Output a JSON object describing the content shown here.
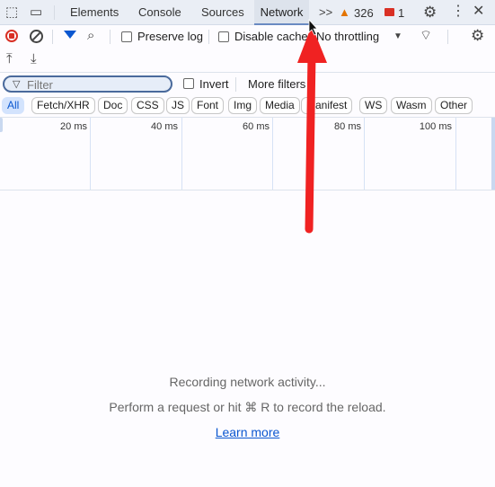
{
  "tabs": [
    "Elements",
    "Console",
    "Sources",
    "Network"
  ],
  "active_tab": "Network",
  "more_tabs": ">>",
  "warnings_count": "326",
  "errors_count": "1",
  "toolbar": {
    "preserve_log": "Preserve log",
    "disable_cache": "Disable cache",
    "throttling": "No throttling"
  },
  "filter": {
    "placeholder": "Filter",
    "invert": "Invert",
    "more_filters": "More filters"
  },
  "chips": [
    "All",
    "Fetch/XHR",
    "Doc",
    "CSS",
    "JS",
    "Font",
    "Img",
    "Media",
    "Manifest",
    "WS",
    "Wasm",
    "Other"
  ],
  "selected_chip": "All",
  "timeline": [
    "20 ms",
    "40 ms",
    "60 ms",
    "80 ms",
    "100 ms"
  ],
  "empty": {
    "recording": "Recording network activity...",
    "hint": "Perform a request or hit ⌘ R to record the reload.",
    "learn_more": "Learn more"
  },
  "colors": {
    "record": "#d93025",
    "accent": "#0b57d0",
    "arrow": "#f02222",
    "warning": "#e37400",
    "error": "#d93025"
  }
}
